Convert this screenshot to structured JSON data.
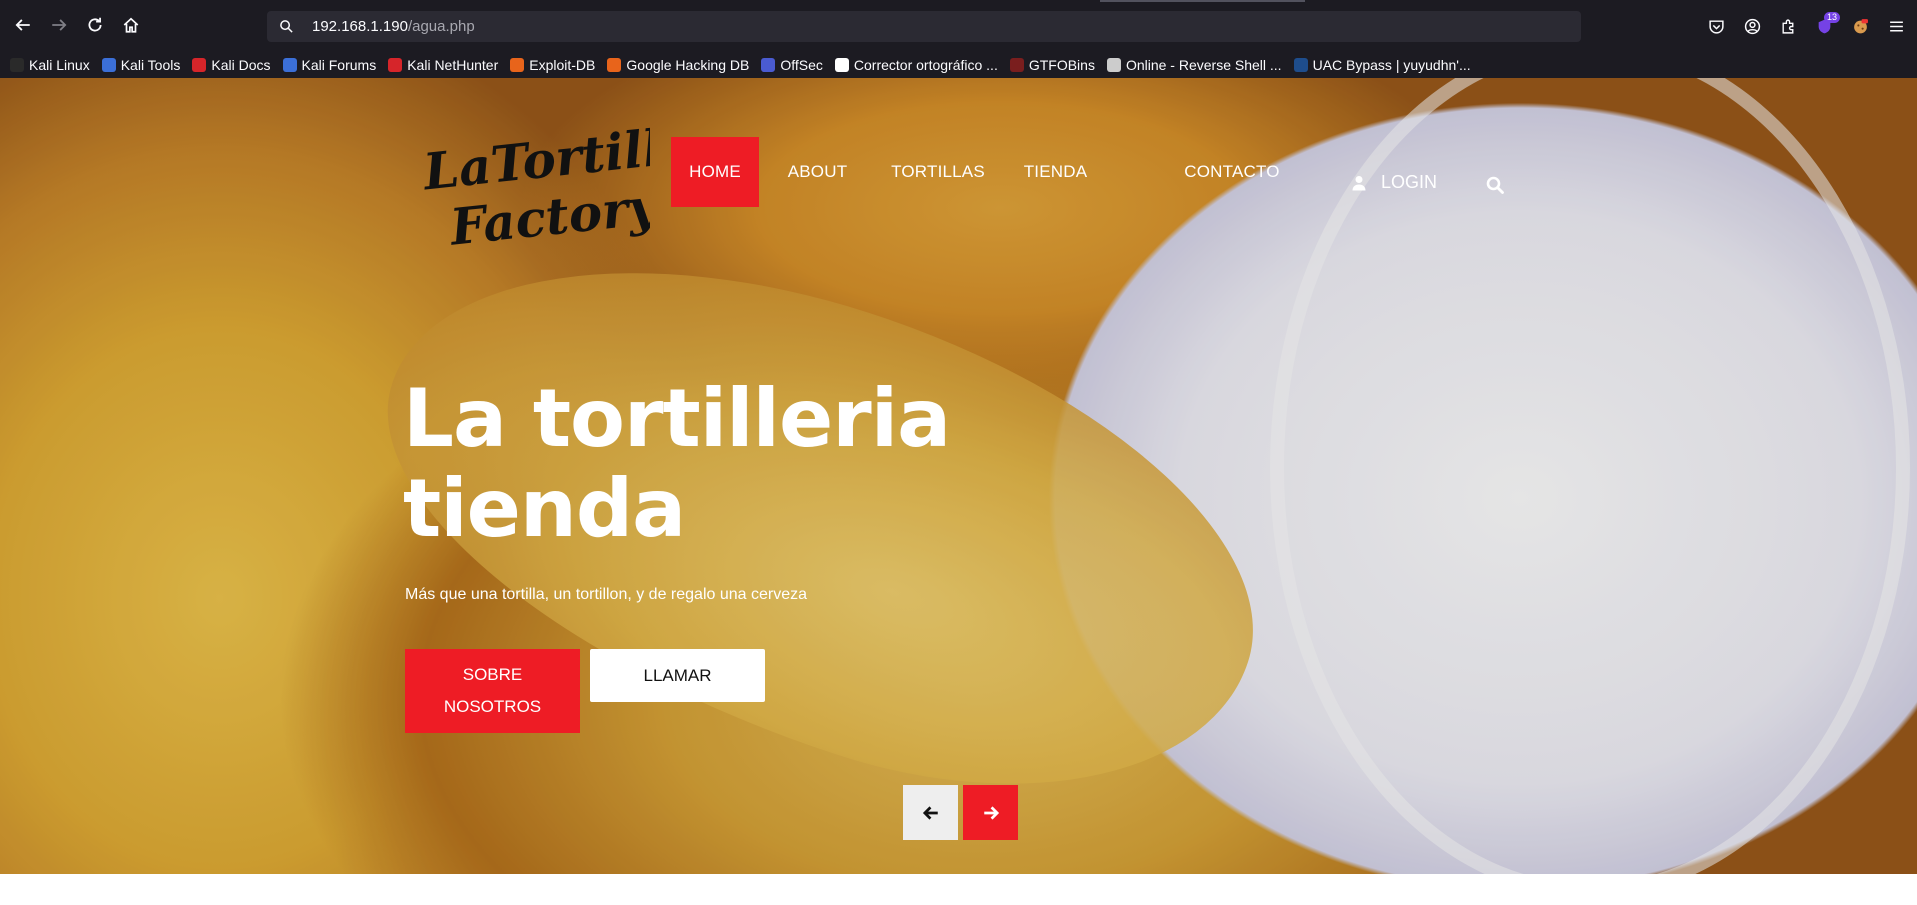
{
  "browser": {
    "url_host": "192.168.1.190",
    "url_path": "/agua.php",
    "back_icon": "arrow-left-icon",
    "forward_icon": "arrow-right-icon",
    "reload_icon": "reload-icon",
    "home_icon": "home-icon",
    "extensions_badge": "13",
    "bookmarks": [
      {
        "label": "Kali Linux",
        "icon": "kali-icon",
        "color": "#2a2a2a"
      },
      {
        "label": "Kali Tools",
        "icon": "kali-tools-icon",
        "color": "#3b6fd8"
      },
      {
        "label": "Kali Docs",
        "icon": "kali-docs-icon",
        "color": "#d6252a"
      },
      {
        "label": "Kali Forums",
        "icon": "kali-forums-icon",
        "color": "#3b6fd8"
      },
      {
        "label": "Kali NetHunter",
        "icon": "nethunter-icon",
        "color": "#d6252a"
      },
      {
        "label": "Exploit-DB",
        "icon": "exploit-db-icon",
        "color": "#e8641b"
      },
      {
        "label": "Google Hacking DB",
        "icon": "ghdb-icon",
        "color": "#e8641b"
      },
      {
        "label": "OffSec",
        "icon": "offsec-icon",
        "color": "#4a5bd1"
      },
      {
        "label": "Corrector ortográfico ...",
        "icon": "corrector-icon",
        "color": "#ffffff"
      },
      {
        "label": "GTFOBins",
        "icon": "gtfobins-icon",
        "color": "#7a1e1e"
      },
      {
        "label": "Online - Reverse Shell ...",
        "icon": "skull-icon",
        "color": "#cccccc"
      },
      {
        "label": "UAC Bypass | yuyudhn'...",
        "icon": "uac-icon",
        "color": "#1e4d8c"
      }
    ]
  },
  "site": {
    "logo_line1": "LaTortilla",
    "logo_line2": "Factory",
    "nav": [
      {
        "label": "HOME",
        "active": true
      },
      {
        "label": "ABOUT",
        "active": false
      },
      {
        "label": "TORTILLAS",
        "active": false
      },
      {
        "label": "TIENDA",
        "active": false
      },
      {
        "label": "CONTACTO",
        "active": false
      }
    ],
    "login_label": "LOGIN",
    "headline": "La tortilleria tienda",
    "subline": "Más que una tortilla, un tortillon, y de regalo una cerveza",
    "btn_primary": "SOBRE NOSOTROS",
    "btn_secondary": "LLAMAR",
    "accent_color": "#ee1c25"
  }
}
